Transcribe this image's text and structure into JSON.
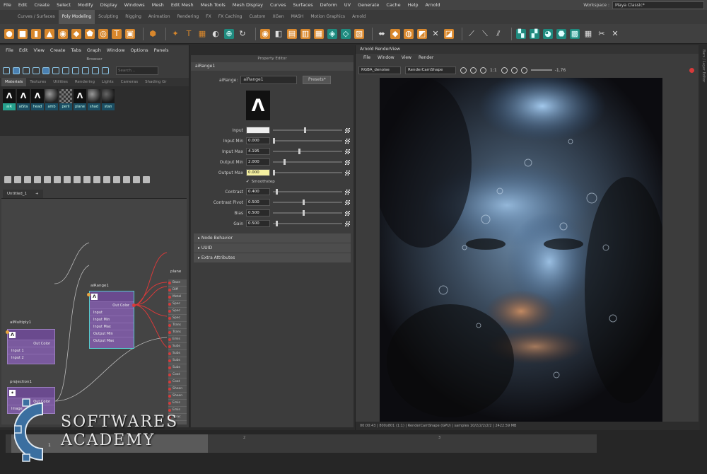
{
  "menubar": {
    "items": [
      "File",
      "Edit",
      "Create",
      "Select",
      "Modify",
      "Display",
      "Windows",
      "Mesh",
      "Edit Mesh",
      "Mesh Tools",
      "Mesh Display",
      "Curves",
      "Surfaces",
      "Deform",
      "UV",
      "Generate",
      "Cache",
      "Help",
      "Arnold"
    ],
    "workspace_label": "Workspace :",
    "workspace_value": "Maya Classic*"
  },
  "shelf": {
    "tabs": [
      "Curves / Surfaces",
      "Poly Modeling",
      "Sculpting",
      "Rigging",
      "Animation",
      "Rendering",
      "FX",
      "FX Caching",
      "Custom",
      "XGen",
      "MASH",
      "Motion Graphics",
      "Arnold"
    ],
    "active_tab": "Poly Modeling"
  },
  "hypershade": {
    "menu": [
      "File",
      "Edit",
      "View",
      "Create",
      "Tabs",
      "Graph",
      "Window",
      "Options",
      "Panels"
    ],
    "browser_title": "Browser",
    "search_placeholder": "Search...",
    "mat_tabs": [
      "Materials",
      "Textures",
      "Utilities",
      "Rendering",
      "Lights",
      "Cameras",
      "Shading Gr"
    ],
    "swatches": [
      "aiR",
      "aiSta",
      "head",
      "amb",
      "perli",
      "plane",
      "shad",
      "stan"
    ],
    "graph_tab": "Untitled_1",
    "graph_tab_add": "+"
  },
  "nodes": {
    "range": {
      "title": "aiRange1",
      "out": "Out Color",
      "inputs": [
        "Input",
        "Input Min",
        "Input Max",
        "Output Min",
        "Output Max"
      ]
    },
    "multiply": {
      "title": "aiMultiply1",
      "out": "Out Color",
      "inputs": [
        "Input 1",
        "Input 2"
      ]
    },
    "projection": {
      "title": "projection1",
      "out": "Out Color",
      "inputs": [
        "Image"
      ]
    },
    "plane": {
      "title": "plane",
      "rows": [
        "Base",
        "Diff",
        "Metal",
        "Spec",
        "Spec",
        "Spec",
        "Trans",
        "Trans",
        "Emis",
        "Subs",
        "Subs",
        "Subs",
        "Subs",
        "Coat",
        "Coat",
        "Sheen",
        "Sheen",
        "Emis",
        "Emis",
        "Opac"
      ]
    }
  },
  "property_editor": {
    "title": "Property Editor",
    "tab": "aiRange1",
    "name_label": "aiRange:",
    "name_value": "aiRange1",
    "presets": "Presets*",
    "attrs": [
      {
        "label": "Input",
        "value": "",
        "knob": 0.46,
        "kind": "color"
      },
      {
        "label": "Input Min",
        "value": "0.000",
        "knob": 0.0
      },
      {
        "label": "Input Max",
        "value": "4.195",
        "knob": 0.38
      },
      {
        "label": "Output Min",
        "value": "2.000",
        "knob": 0.16
      },
      {
        "label": "Output Max",
        "value": "0.000",
        "knob": 0.0,
        "hl": true
      }
    ],
    "smoothstep": "Smoothstep",
    "attrs2": [
      {
        "label": "Contrast",
        "value": "0.400",
        "knob": 0.04
      },
      {
        "label": "Contrast Pivot",
        "value": "0.500",
        "knob": 0.44
      },
      {
        "label": "Bias",
        "value": "0.500",
        "knob": 0.44
      },
      {
        "label": "Gain",
        "value": "0.500",
        "knob": 0.04
      }
    ],
    "sections": [
      "Node Behavior",
      "UUID",
      "Extra Attributes"
    ]
  },
  "render_view": {
    "title": "Arnold RenderView",
    "menu": [
      "File",
      "Window",
      "View",
      "Render"
    ],
    "aov": "RGBA_denoise",
    "camera": "RenderCamShape",
    "ratio": "1:1",
    "exposure": "-1.76",
    "status": "00:00:43 | 800x801 (1:1) | RenderCamShape (GPU) | samples 10/2/2/2/2/2 | 2422.59 MB",
    "side_label": "Bars / Layer Editor"
  },
  "timeline": {
    "frame": "1",
    "ticks": [
      "2",
      "3"
    ]
  },
  "watermark": {
    "line1": "SOFTWARES",
    "line2": "ACADEMY"
  },
  "colors": {
    "node_purple": "#7a5a9e",
    "shelf_orange": "#d8872c",
    "accent_teal": "#26a18e",
    "highlight_yellow": "#f5f0a0"
  }
}
